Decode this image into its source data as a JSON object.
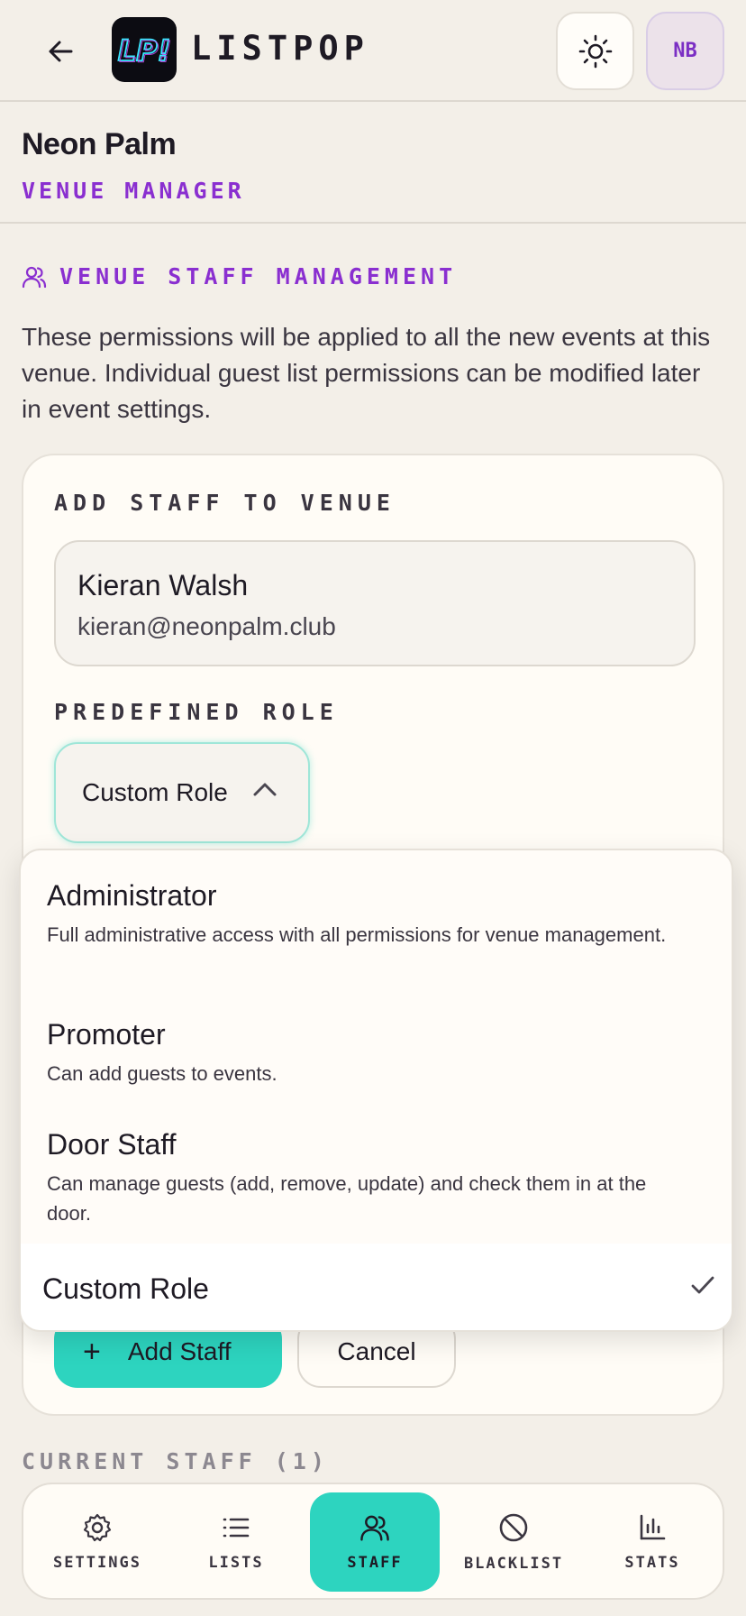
{
  "header": {
    "logo_text": "LP!",
    "brand": "LISTPOP",
    "avatar_initials": "NB"
  },
  "venue": {
    "name": "Neon Palm",
    "role": "VENUE MANAGER"
  },
  "staff_section": {
    "title": "VENUE STAFF MANAGEMENT",
    "description": "These permissions will be applied to all the new events at this venue. Individual guest list permissions can be modified later in event settings."
  },
  "card": {
    "add_label": "ADD STAFF TO VENUE",
    "person_name": "Kieran Walsh",
    "person_email": "kieran@neonpalm.club",
    "role_label": "PREDEFINED ROLE",
    "role_value": "Custom Role",
    "add_button": "Add Staff",
    "cancel_button": "Cancel"
  },
  "dropdown": {
    "options": [
      {
        "title": "Administrator",
        "desc": "Full administrative access with all permissions for venue management."
      },
      {
        "title": "Promoter",
        "desc": "Can add guests to events."
      },
      {
        "title": "Door Staff",
        "desc": "Can manage guests (add, remove, update) and check them in at the door."
      },
      {
        "title": "Custom Role",
        "desc": ""
      }
    ],
    "selected": "Custom Role"
  },
  "current_staff": "CURRENT STAFF (1)",
  "nav": {
    "items": [
      {
        "label": "SETTINGS",
        "icon": "gear-icon"
      },
      {
        "label": "LISTS",
        "icon": "list-icon"
      },
      {
        "label": "STAFF",
        "icon": "users-icon"
      },
      {
        "label": "BLACKLIST",
        "icon": "ban-icon"
      },
      {
        "label": "STATS",
        "icon": "bar-chart-icon"
      }
    ],
    "active": "STAFF"
  },
  "colors": {
    "accent_purple": "#8a2fd0",
    "accent_teal": "#2dd4bf",
    "background": "#f3efe8"
  }
}
